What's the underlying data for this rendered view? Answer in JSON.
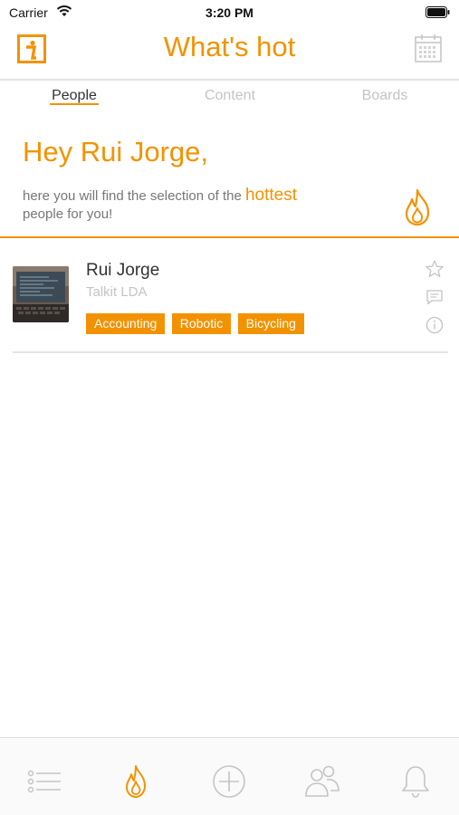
{
  "status_bar": {
    "carrier": "Carrier",
    "time": "3:20 PM"
  },
  "nav": {
    "title": "What's hot",
    "left_icon": "info-icon",
    "right_icon": "calendar-icon"
  },
  "tabs": [
    {
      "label": "People",
      "active": true
    },
    {
      "label": "Content",
      "active": false
    },
    {
      "label": "Boards",
      "active": false
    }
  ],
  "hero": {
    "greeting": "Hey Rui Jorge,",
    "text_before": "here you will find the selection of the ",
    "highlight": "hottest",
    "text_after": "people for you!",
    "icon": "flame-icon"
  },
  "people": [
    {
      "name": "Rui Jorge",
      "company": "Talkit LDA",
      "tags": [
        "Accounting",
        "Robotic",
        "Bicycling"
      ]
    }
  ],
  "tabbar": [
    "list-icon",
    "flame-icon",
    "add-icon",
    "people-icon",
    "bell-icon"
  ],
  "colors": {
    "accent": "#f39200",
    "muted": "#c4c4c4",
    "divider": "#e4e4e4"
  }
}
